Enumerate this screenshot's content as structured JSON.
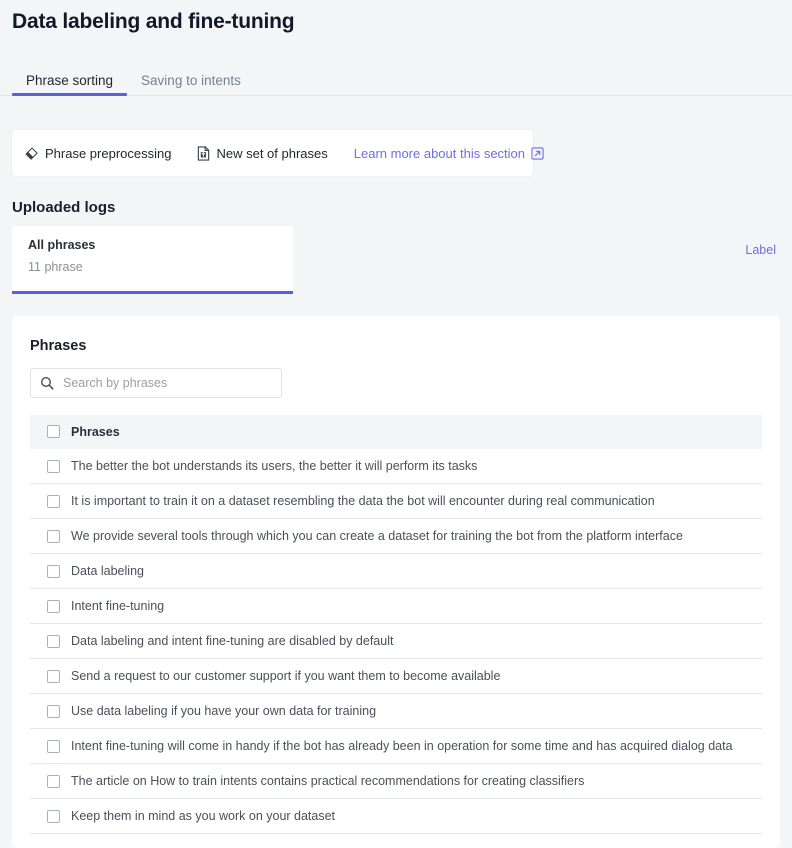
{
  "header": {
    "title": "Data labeling and fine-tuning"
  },
  "tabs": [
    {
      "label": "Phrase sorting",
      "active": true
    },
    {
      "label": "Saving to intents",
      "active": false
    }
  ],
  "toolbar": {
    "items": [
      {
        "label": "Phrase preprocessing",
        "icon": "eraser-icon",
        "kind": "action"
      },
      {
        "label": "New set of phrases",
        "icon": "file-upload-icon",
        "kind": "action"
      },
      {
        "label": "Learn more about this section",
        "icon": "external-link-icon",
        "kind": "link"
      }
    ]
  },
  "uploaded_logs": {
    "section_title": "Uploaded logs",
    "card": {
      "name": "All phrases",
      "count": "11 phrase",
      "action_label": "Label"
    }
  },
  "phrases_panel": {
    "title": "Phrases",
    "search": {
      "placeholder": "Search by phrases",
      "value": "",
      "icon": "search-icon"
    },
    "table": {
      "header": "Phrases",
      "rows": [
        "The better the bot understands its users, the better it will perform its tasks",
        "It is important to train it on a dataset resembling the data the bot will encounter during real communication",
        "We provide several tools through which you can create a dataset for training the bot from the platform interface",
        "Data labeling",
        "Intent fine-tuning",
        "Data labeling and intent fine-tuning are disabled by default",
        "Send a request to our customer support if you want them to become available",
        "Use data labeling if you have your own data for training",
        "Intent fine-tuning will come in handy if the bot has already been in operation for some time and has acquired dialog data",
        "The article on How to train intents contains practical recommendations for creating classifiers",
        "Keep them in mind as you work on your dataset"
      ]
    }
  },
  "colors": {
    "accent": "#5b5fdb",
    "link": "#6c70e0",
    "page_bg": "#f4f5f7",
    "card_bg": "#ffffff",
    "text": "#23272f",
    "muted": "#8b9097",
    "border": "#e6e9ec"
  }
}
